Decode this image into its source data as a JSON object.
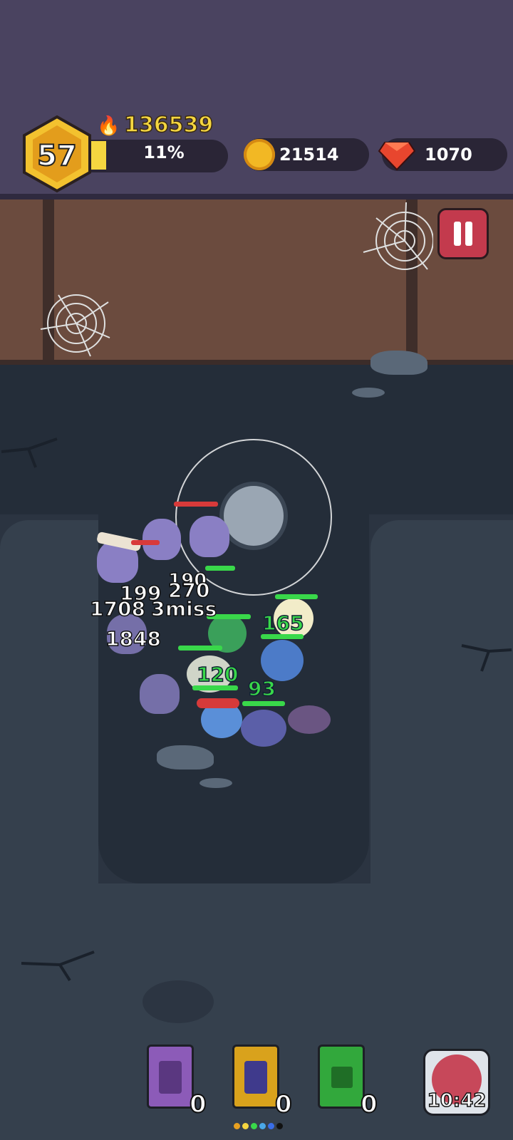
{
  "hud": {
    "level": "57",
    "power": "136539",
    "xp_percent_label": "11%",
    "xp_fraction": 0.11,
    "gold": "21514",
    "gems": "1070"
  },
  "combat_text": {
    "enemy_damage": [
      "199",
      "270",
      "190",
      "1708",
      "3",
      "miss",
      "1848"
    ],
    "heal_values": [
      "165",
      "120",
      "93"
    ]
  },
  "skill_books": [
    {
      "name": "lightning-book",
      "count": "0",
      "color": "#8c5bb8"
    },
    {
      "name": "wing-book",
      "count": "0",
      "color": "#d9a21c"
    },
    {
      "name": "heal-book",
      "count": "0",
      "color": "#32a83c"
    }
  ],
  "timer": {
    "label": "10:42"
  },
  "colors": {
    "accent_gold": "#f5d640",
    "hp_green": "#39d84a",
    "enemy_red": "#d83a3a",
    "pause_red": "#c33a4d"
  }
}
